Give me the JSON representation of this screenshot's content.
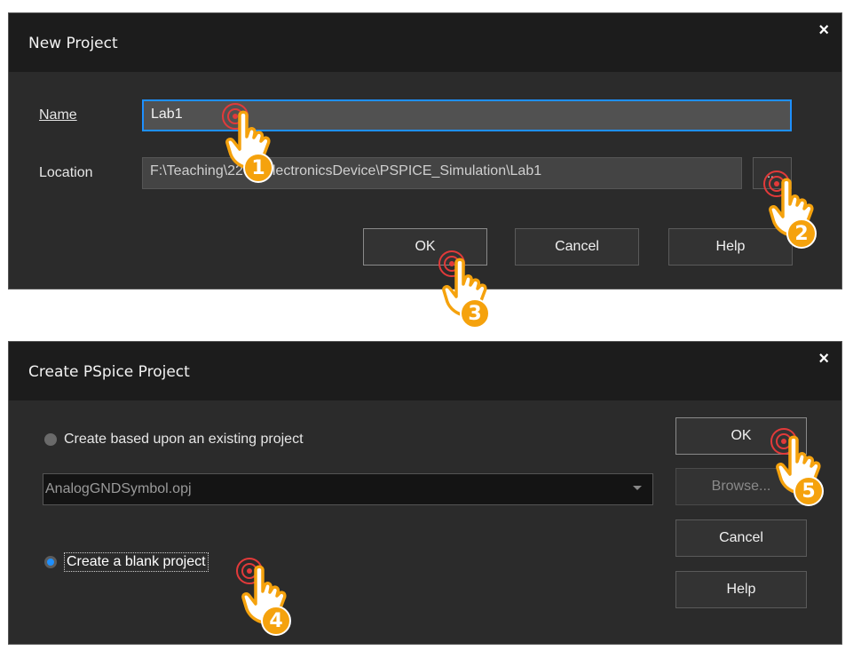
{
  "dialog1": {
    "title": "New Project",
    "close": "×",
    "name_label": "Name",
    "name_value": "Lab1",
    "location_label": "Location",
    "location_value": "F:\\Teaching\\2203\\ElectronicsDevice\\PSPICE_Simulation\\Lab1",
    "browse_label": "...",
    "ok_label": "OK",
    "cancel_label": "Cancel",
    "help_label": "Help"
  },
  "dialog2": {
    "title": "Create PSpice Project",
    "close": "×",
    "option_existing": "Create based upon an existing project",
    "dropdown_value": "AnalogGNDSymbol.opj",
    "option_blank": "Create a blank project",
    "ok_label": "OK",
    "browse_label": "Browse...",
    "cancel_label": "Cancel",
    "help_label": "Help"
  },
  "steps": [
    "1",
    "2",
    "3",
    "4",
    "5"
  ],
  "colors": {
    "dialog_bg": "#2b2b2b",
    "titlebar_bg": "#1c1c1c",
    "input_border_focus": "#1e90ff",
    "radio_selected": "#1e90ff",
    "badge": "#f5a20d",
    "ring": "#e23a3a"
  }
}
